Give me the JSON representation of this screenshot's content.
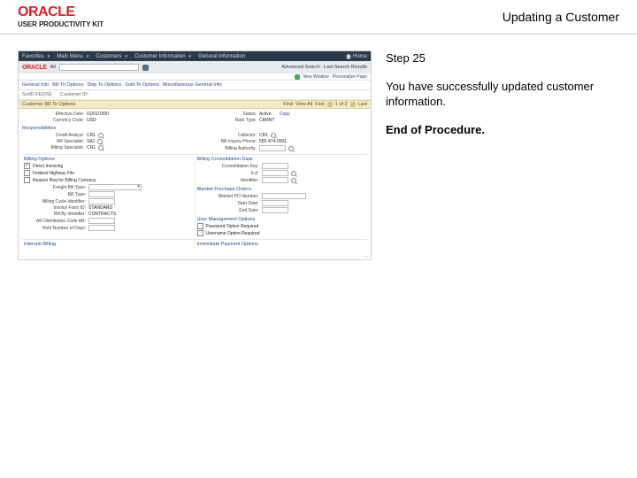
{
  "header": {
    "brand": "ORACLE",
    "brand_sub": "USER PRODUCTIVITY KIT",
    "page_title": "Updating a Customer"
  },
  "instruction": {
    "step": "Step 25",
    "body": "You have successfully updated customer information.",
    "eop": "End of Procedure."
  },
  "app": {
    "nav": {
      "favorites": "Favorites",
      "main": "Main Menu",
      "customers": "Customers",
      "custinfo": "Customer Information",
      "general": "General Information",
      "home": "Home"
    },
    "oracle": "ORACLE",
    "search_label": "All",
    "search_sub": "Search",
    "right1": "Advanced Search",
    "right2": "Last Search Results",
    "bar3": {
      "newwin": "New Window",
      "personalize": "Personalize Page"
    },
    "tabs": {
      "t1": "General Info",
      "t2": "Bill To Options",
      "t3": "Ship To Options",
      "t4": "Sold To Options",
      "t5": "Miscellaneous General Info"
    },
    "crumb_l": "SetID  FEDSE",
    "crumb_r": "Customer ID:",
    "banner": {
      "title": "Customer Bill To Options",
      "find": "Find",
      "view": "View All",
      "first": "First",
      "pg": "1 of 2",
      "last": "Last"
    },
    "row1": {
      "left_l": "Effective Date:",
      "left_v": "01/01/1900",
      "right_l": "Status:",
      "right_v": "Active",
      "far_r": "Copy"
    },
    "row2": {
      "left_l": "Currency Code:",
      "left_v": "USD",
      "right_l": "Rate Type:",
      "right_v": "CRRNT"
    },
    "responsibilities": "Responsibilities",
    "resp": {
      "r1l": "Credit Analyst:",
      "r1v": "CR1",
      "r1rl": "Collector:",
      "r1rv": "CR1",
      "r2l": "AR Specialist:",
      "r2v": "SA1",
      "r2rl": "Bill Inquiry Phone:",
      "r2rv": "555-474-0001",
      "r3l": "Billing Specialist:",
      "r3v": "CR1",
      "r3rl": "Billing Authority:"
    },
    "billopts": "Billing Options",
    "bo": {
      "b1": "Direct Invoicing",
      "b1c": true,
      "b2": "Federal Highway File",
      "b2c": false,
      "b3": "Reason Req for Billing Currency",
      "b3c": false,
      "b4l": "Freight Bill Type:",
      "b5l": "Bill Type:",
      "b6l": "Billing Cycle Identifier:",
      "b7l": "Invoice Form ID:",
      "b7v": "STANDARD",
      "b8l": "Bill By Identifier:",
      "b8v": "CONTRACTS",
      "b9l": "AR Distribution Code AR:",
      "b10l": "Hold Number of Days:"
    },
    "bci": "Billing Consolidation Data",
    "bc": {
      "c1l": "Consolidation Key:",
      "c2l": "ILvl:",
      "c3l": "Identifier:"
    },
    "bpo": "Blanket Purchase Orders",
    "bp": {
      "p1l": "Blanket PO Number:",
      "p2l": "Start Date:",
      "p3l": "End Date:"
    },
    "umo": "User Management Options",
    "um": {
      "u1": "Password Option Required",
      "u2": "Username Option Required"
    },
    "foot": {
      "l": "Interunit Billing",
      "r": "Immediate Payment Options"
    }
  }
}
